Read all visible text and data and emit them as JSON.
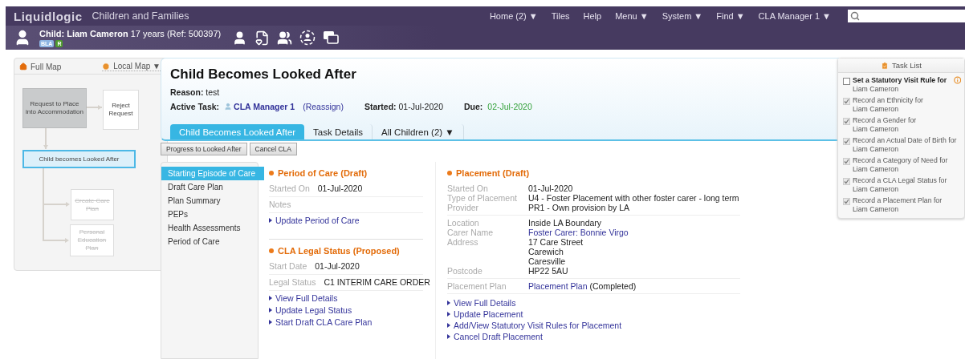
{
  "header": {
    "logo": "Liquidlogic",
    "product": "Children and Families",
    "nav": [
      {
        "label": "Home (2) ▼"
      },
      {
        "label": "Tiles"
      },
      {
        "label": "Help"
      },
      {
        "label": "Menu ▼"
      },
      {
        "label": "System ▼"
      },
      {
        "label": "Find ▼"
      },
      {
        "label": "CLA Manager 1 ▼"
      }
    ]
  },
  "child_bar": {
    "summary": "**Child: Liam Cameron** 17 years (Ref: 500397)",
    "badges": [
      {
        "label": "BLA",
        "color": "#8eb4e3"
      },
      {
        "label": "R",
        "color": "#4e9a2e"
      }
    ]
  },
  "map": {
    "tabs": [
      {
        "label": "Full Map",
        "selected": false
      },
      {
        "label": "Local Map ▼",
        "selected": true
      }
    ],
    "nodes": [
      {
        "label": "Request to Place into Accommodation",
        "kind": "done"
      },
      {
        "label": "Reject Request",
        "kind": "option"
      },
      {
        "label": "Child becomes Looked After",
        "kind": "current"
      },
      {
        "label": "Create Care Plan",
        "kind": "pending"
      },
      {
        "label": "Personal Education Plan",
        "kind": "pending"
      }
    ]
  },
  "task": {
    "title": "Child Becomes Looked After",
    "reason": "**Reason:** test",
    "active_task_label": "Active Task:",
    "assignee": "CLA Manager 1",
    "reassign": "(Reassign)",
    "started": "**Started:** 01-Jul-2020",
    "due_label": "Due:",
    "due": "02-Jul-2020",
    "tabs": [
      {
        "label": "Child Becomes Looked After",
        "selected": true
      },
      {
        "label": "Task Details",
        "selected": false
      },
      {
        "label": "All Children (2) ▼",
        "selected": false
      }
    ]
  },
  "actions": [
    "Progress to Looked After",
    "Cancel CLA"
  ],
  "side_nav": [
    {
      "label": "Starting Episode of Care",
      "selected": true
    },
    {
      "label": "Draft Care Plan",
      "selected": false
    },
    {
      "label": "Plan Summary",
      "selected": false
    },
    {
      "label": "PEPs",
      "selected": false
    },
    {
      "label": "Health Assessments",
      "selected": false
    },
    {
      "label": "Period of Care",
      "selected": false
    }
  ],
  "sections": [
    {
      "title": "Period of Care (Draft)",
      "fields": [
        {
          "label": "Started On",
          "value": "01-Jul-2020"
        },
        {
          "label": "Notes"
        }
      ],
      "links": [
        "Update Period of Care"
      ]
    },
    {
      "title": "CLA Legal Status (Proposed)",
      "fields": [
        {
          "label": "Start Date",
          "value": "01-Jul-2020"
        },
        {
          "label": "Legal Status",
          "value": "C1 INTERIM CARE ORDER"
        }
      ],
      "links": [
        "View Full Details",
        "Update Legal Status",
        "Start Draft CLA Care Plan"
      ]
    }
  ],
  "placement": {
    "title": "Placement (Draft)",
    "groups": [
      [
        {
          "label": "Started On",
          "kind": "text",
          "value": "01-Jul-2020"
        },
        {
          "label": "Type of Placement",
          "kind": "text",
          "value": "U4 - Foster Placement with other foster carer - long term"
        },
        {
          "label": "Provider",
          "kind": "text",
          "value": "PR1 - Own provision by LA"
        }
      ],
      [
        {
          "label": "Location",
          "kind": "text",
          "value": "Inside LA Boundary"
        },
        {
          "label": "Carer Name",
          "kind": "link",
          "value": "Foster Carer: Bonnie Virgo"
        },
        {
          "label": "Address",
          "kind": "lines",
          "lines": [
            "17 Care Street",
            "Carewich",
            "Caresville"
          ]
        },
        {
          "label": "Postcode",
          "kind": "text",
          "value": "HP22 5AU"
        }
      ],
      [
        {
          "label": "Placement Plan",
          "kind": "link",
          "value": "Placement Plan",
          "note": "(Completed)"
        }
      ]
    ],
    "links": [
      "View Full Details",
      "Update Placement",
      "Add/View Statutory Visit Rules for Placement",
      "Cancel Draft Placement"
    ]
  },
  "task_list": {
    "title": "Task List",
    "items": [
      {
        "title": "Set a Statutory Visit Rule for",
        "subject": "Liam Cameron",
        "checked": false
      },
      {
        "title": "Record an Ethnicity for",
        "subject": "Liam Cameron",
        "checked": true
      },
      {
        "title": "Record a Gender for",
        "subject": "Liam Cameron",
        "checked": true
      },
      {
        "title": "Record an Actual Date of Birth for",
        "subject": "Liam Cameron",
        "checked": true
      },
      {
        "title": "Record a Category of Need for",
        "subject": "Liam Cameron",
        "checked": true
      },
      {
        "title": "Record a CLA Legal Status for",
        "subject": "Liam Cameron",
        "checked": true
      },
      {
        "title": "Record a Placement Plan for",
        "subject": "Liam Cameron",
        "checked": true
      }
    ]
  }
}
